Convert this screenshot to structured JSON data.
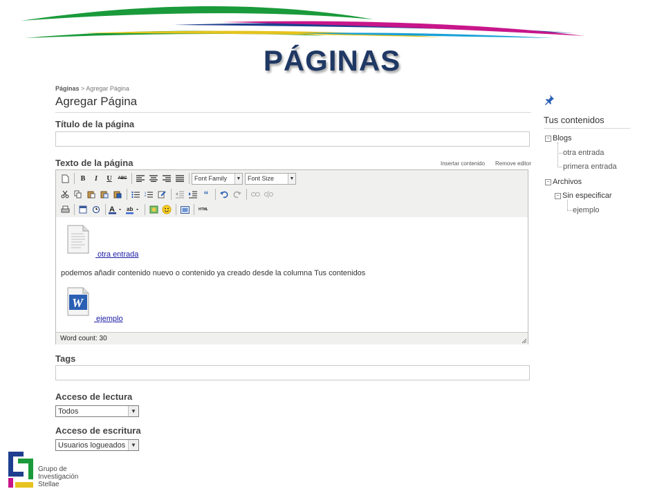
{
  "slide": {
    "title": "PÁGINAS",
    "brand_colors": [
      "#1a9a3a",
      "#c8168a",
      "#1e3f8f",
      "#e6c31e",
      "#19a0d6"
    ]
  },
  "breadcrumb": {
    "root": "Páginas",
    "separator": ">",
    "current": "Agregar Página"
  },
  "page_heading": "Agregar Página",
  "form": {
    "title_label": "Título de la página",
    "title_value": "",
    "text_label": "Texto de la página",
    "insert_content_link": "Insertar contenido",
    "remove_editor_link": "Remove editor",
    "tags_label": "Tags",
    "tags_value": "",
    "read_access_label": "Acceso de lectura",
    "read_access_value": "Todos",
    "write_access_label": "Acceso de escritura",
    "write_access_value": "Usuarios logueados"
  },
  "editor": {
    "font_family": "Font Family",
    "font_size": "Font Size",
    "toolbar_row1": [
      "new-document",
      "bold",
      "italic",
      "underline",
      "strikethrough",
      "align-left",
      "align-center",
      "align-right",
      "align-justify"
    ],
    "toolbar_row2": [
      "cut",
      "copy",
      "paste",
      "paste-text",
      "paste-word",
      "bullet-list",
      "numbered-list",
      "edit",
      "outdent",
      "indent",
      "blockquote",
      "undo",
      "redo",
      "link",
      "unlink"
    ],
    "toolbar_row3": [
      "print",
      "date",
      "time",
      "text-color",
      "highlight-color",
      "image",
      "emoticon",
      "media",
      "html"
    ],
    "bold_glyph": "B",
    "italic_glyph": "I",
    "underline_glyph": "U",
    "strike_glyph": "ABC",
    "html_glyph": "HTML",
    "link1": " otra entrada",
    "body_text": "podemos añadir contenido nuevo o contenido ya creado desde la columna Tus contenidos",
    "link2": " ejemplo",
    "status": "Word count: 30"
  },
  "sidebar": {
    "title": "Tus contenidos",
    "tree": {
      "blogs": "Blogs",
      "blog_items": [
        "otra entrada",
        "primera entrada"
      ],
      "archivos": "Archivos",
      "folder": "Sin especificar",
      "file": "ejemplo",
      "toggle_glyph": "−"
    }
  },
  "logo": {
    "lines": [
      "Grupo de",
      "Investigación",
      "Stellae"
    ]
  }
}
